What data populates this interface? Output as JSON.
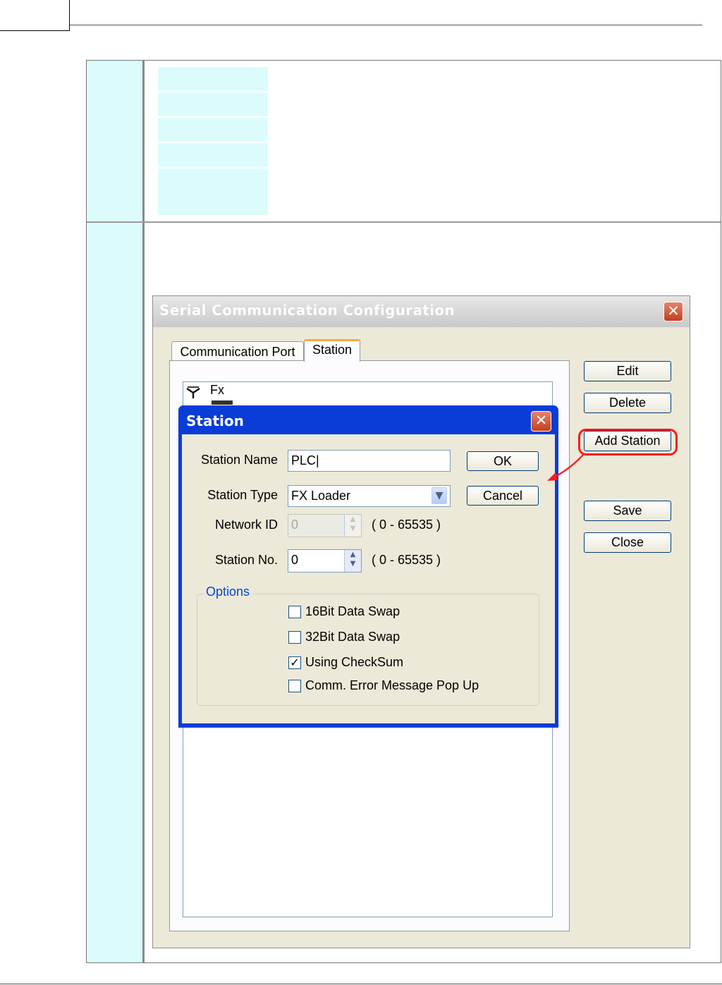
{
  "main_dialog": {
    "title": "Serial Communication Configuration",
    "close_glyph": "✕",
    "tabs": [
      {
        "label": "Communication Port",
        "active": false
      },
      {
        "label": "Station",
        "active": true
      }
    ],
    "tree": {
      "root_label": "Fx",
      "root_icon": "antenna-icon"
    },
    "buttons": {
      "edit": "Edit",
      "delete": "Delete",
      "add_station": "Add Station",
      "save": "Save",
      "close": "Close"
    },
    "highlight_color": "#ff1a1a"
  },
  "station_dialog": {
    "title": "Station",
    "close_glyph": "✕",
    "fields": {
      "station_name": {
        "label": "Station Name",
        "value": "PLC|"
      },
      "station_type": {
        "label": "Station Type",
        "value": "FX Loader",
        "icon": "chevron-down-icon"
      },
      "network_id": {
        "label": "Network ID",
        "value": "0",
        "range": "( 0 - 65535 )",
        "enabled": false
      },
      "station_no": {
        "label": "Station No.",
        "value": "0",
        "range": "( 0 - 65535 )",
        "enabled": true
      }
    },
    "buttons": {
      "ok": "OK",
      "cancel": "Cancel"
    },
    "options": {
      "legend": "Options",
      "items": [
        {
          "label": "16Bit Data Swap",
          "checked": false
        },
        {
          "label": "32Bit Data Swap",
          "checked": false
        },
        {
          "label": "Using CheckSum",
          "checked": true
        },
        {
          "label": "Comm. Error Message Pop Up",
          "checked": false
        }
      ]
    }
  },
  "colors": {
    "table_left_fill": "#dcfcfc",
    "station_titlebar": "#0a3cd8",
    "dialog_face": "#ece9d8",
    "options_legend": "#0046d5"
  }
}
